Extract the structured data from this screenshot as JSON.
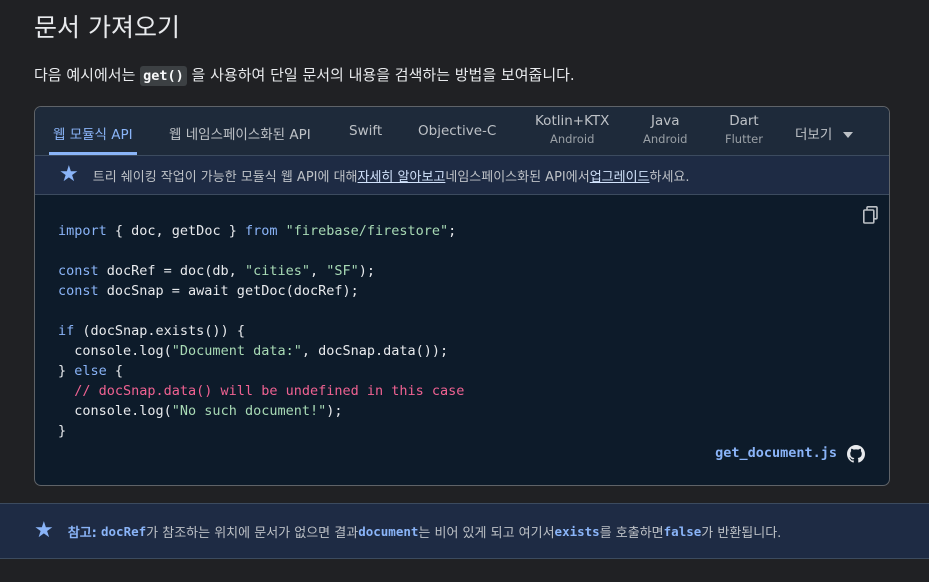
{
  "page": {
    "heading": "문서 가져오기",
    "intro_before": "다음 예시에서는 ",
    "intro_code": "get()",
    "intro_after": " 을 사용하여 단일 문서의 내용을 검색하는 방법을 보여줍니다."
  },
  "tabs": [
    {
      "label": "웹 모듈식 API",
      "sub": ""
    },
    {
      "label": "웹 네임스페이스화된 API",
      "sub": ""
    },
    {
      "label": "Swift",
      "sub": ""
    },
    {
      "label": "Objective-C",
      "sub": ""
    },
    {
      "label": "Kotlin+KTX",
      "sub": "Android"
    },
    {
      "label": "Java",
      "sub": "Android"
    },
    {
      "label": "Dart",
      "sub": "Flutter"
    },
    {
      "label": "더보기",
      "sub": ""
    }
  ],
  "tree_note": {
    "before": "트리 쉐이킹 작업이 가능한 모듈식 웹 API에 대해 ",
    "link1": "자세히 알아보고",
    "middle": " 네임스페이스화된 API에서 ",
    "link2": "업그레이드",
    "after": "하세요."
  },
  "code": {
    "lines": [
      {
        "parts": [
          {
            "t": "import",
            "c": "kw"
          },
          {
            "t": " { doc, getDoc } ",
            "c": ""
          },
          {
            "t": "from",
            "c": "kw"
          },
          {
            "t": " ",
            "c": ""
          },
          {
            "t": "\"firebase/firestore\"",
            "c": "str"
          },
          {
            "t": ";",
            "c": ""
          }
        ]
      },
      {
        "parts": []
      },
      {
        "parts": [
          {
            "t": "const",
            "c": "kw"
          },
          {
            "t": " docRef = doc(db, ",
            "c": ""
          },
          {
            "t": "\"cities\"",
            "c": "str"
          },
          {
            "t": ", ",
            "c": ""
          },
          {
            "t": "\"SF\"",
            "c": "str"
          },
          {
            "t": ");",
            "c": ""
          }
        ]
      },
      {
        "parts": [
          {
            "t": "const",
            "c": "kw"
          },
          {
            "t": " docSnap = await getDoc(docRef);",
            "c": ""
          }
        ]
      },
      {
        "parts": []
      },
      {
        "parts": [
          {
            "t": "if",
            "c": "kw"
          },
          {
            "t": " (docSnap.exists()) {",
            "c": ""
          }
        ]
      },
      {
        "parts": [
          {
            "t": "  console.log(",
            "c": ""
          },
          {
            "t": "\"Document data:\"",
            "c": "str"
          },
          {
            "t": ", docSnap.data());",
            "c": ""
          }
        ]
      },
      {
        "parts": [
          {
            "t": "} ",
            "c": ""
          },
          {
            "t": "else",
            "c": "kw"
          },
          {
            "t": " {",
            "c": ""
          }
        ]
      },
      {
        "parts": [
          {
            "t": "  // docSnap.data() will be undefined in this case",
            "c": "cm"
          }
        ]
      },
      {
        "parts": [
          {
            "t": "  console.log(",
            "c": ""
          },
          {
            "t": "\"No such document!\"",
            "c": "str"
          },
          {
            "t": ");",
            "c": ""
          }
        ]
      },
      {
        "parts": [
          {
            "t": "}",
            "c": ""
          }
        ]
      }
    ],
    "filename": "get_document.js"
  },
  "bottom_note": {
    "label": "참고:",
    "code1": "docRef",
    "t1": "가 참조하는 위치에 문서가 없으면 결과 ",
    "code2": "document",
    "t2": "는 비어 있게 되고 여기서 ",
    "code3": "exists",
    "t3": "를 호출하면 ",
    "code4": "false",
    "t4": "가 반환됩니다."
  },
  "icons": {
    "star": "star-icon",
    "copy": "copy-icon",
    "github": "github-icon",
    "more": "chevron-down-icon"
  },
  "colors": {
    "accent": "#8ab4f8",
    "string": "#a8dab5",
    "comment": "#f06292",
    "bg": "#202124",
    "code_bg": "#0d1b2a"
  }
}
